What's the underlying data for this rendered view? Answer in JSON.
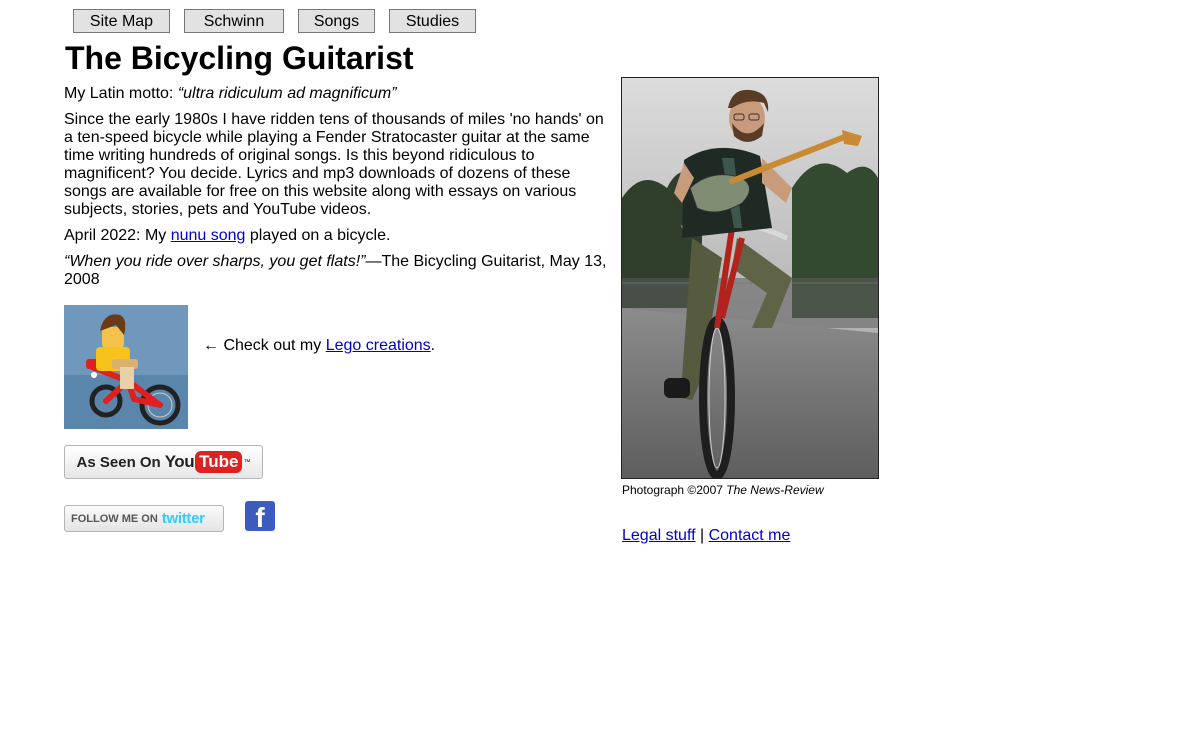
{
  "nav": {
    "items": [
      {
        "label": "Site Map"
      },
      {
        "label": "Schwinn"
      },
      {
        "label": "Songs"
      },
      {
        "label": "Studies"
      }
    ]
  },
  "page": {
    "title": "The Bicycling Guitarist"
  },
  "motto": {
    "prefix": "My Latin motto: ",
    "text": "“ultra ridiculum ad magnificum”"
  },
  "intro": {
    "text": "Since the early 1980s I have ridden tens of thousands of miles 'no hands' on a ten-speed bicycle while playing a Fender Stratocaster guitar at the same time writing hundreds of original songs. Is this beyond ridiculous to magnificent? You decide. Lyrics and mp3 downloads of dozens of these songs are available for free on this website along with essays on various subjects, stories, pets and YouTube videos."
  },
  "news": {
    "prefix": "April 2022: My ",
    "link": "nunu song",
    "suffix": " played on a bicycle."
  },
  "quote": {
    "text": "“When you ride over sharps, you get flats!”",
    "attribution": "—The Bicycling Guitarist, May 13, 2008"
  },
  "lego": {
    "prefix": "← Check out my ",
    "link": "Lego creations",
    "suffix": "."
  },
  "badges": {
    "youtube_prefix": "As Seen On",
    "youtube_you": "You",
    "youtube_tube": "Tube",
    "youtube_tm": "™",
    "twitter_prefix": "FOLLOW ME ON",
    "twitter_brand": "twitter",
    "facebook_glyph": "f"
  },
  "photo": {
    "caption_prefix": "Photograph ©2007 ",
    "caption_source": "The News-Review"
  },
  "footer": {
    "legal": "Legal stuff",
    "separator": " | ",
    "contact": "Contact me"
  }
}
